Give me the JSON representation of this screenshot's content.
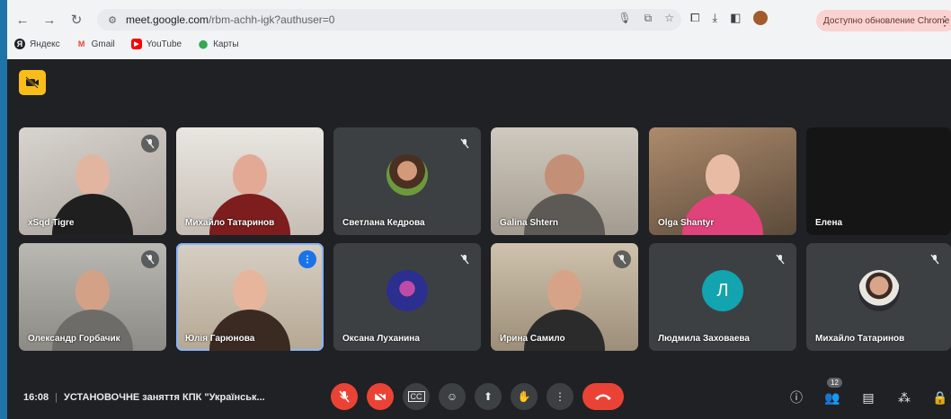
{
  "browser": {
    "url_host": "meet.google.com",
    "url_path": "/rbm-achh-igk?authuser=0",
    "update_label": "Доступно обновление Chrome",
    "bookmarks": [
      {
        "label": "Яндекс",
        "icon": "yandex-icon",
        "color": "#202124"
      },
      {
        "label": "Gmail",
        "icon": "gmail-icon",
        "color": "#ea4335"
      },
      {
        "label": "YouTube",
        "icon": "youtube-icon",
        "color": "#ff0000"
      },
      {
        "label": "Карты",
        "icon": "maps-icon",
        "color": "#34a853"
      }
    ]
  },
  "meeting": {
    "time": "16:08",
    "title": "УСТАНОВОЧНЕ заняття КПК \"Українськ...",
    "participants_count": "12"
  },
  "participants": [
    {
      "name": "xSqd Tigre",
      "muted": true
    },
    {
      "name": "Михайло Татаринов",
      "muted": false
    },
    {
      "name": "Светлана Кедрова",
      "muted": true
    },
    {
      "name": "Galina Shtern",
      "muted": false
    },
    {
      "name": "Olga Shantyr",
      "muted": false
    },
    {
      "name": "Елена",
      "muted": false
    },
    {
      "name": "Олександр Горбачик",
      "muted": true
    },
    {
      "name": "Юлія Гарюнова",
      "muted": false,
      "speaking": true
    },
    {
      "name": "Оксана Луханина",
      "muted": true
    },
    {
      "name": "Ирина Самило",
      "muted": true
    },
    {
      "name": "Людмила Заховаева",
      "muted": true,
      "initial": "Л"
    },
    {
      "name": "Михайло Татаринов",
      "muted": true
    }
  ],
  "colors": {
    "accent": "#1a73e8",
    "danger": "#ea4335",
    "cam_badge": "#f9bd1a",
    "initial_avatar": "#12a4af"
  }
}
